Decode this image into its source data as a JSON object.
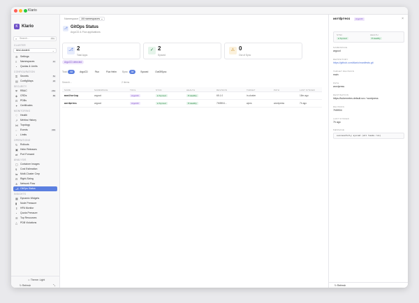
{
  "window": {
    "title": "Klario"
  },
  "sidebar": {
    "brand": "Klario",
    "logo_letter": "K",
    "search_placeholder": "Search...",
    "search_kbd": "⌘K",
    "cluster_label": "CLUSTER",
    "cluster_value": "kind-cluster1",
    "sections": [
      {
        "label": "CLUSTER",
        "items": [
          {
            "label": "Settings",
            "icon": "gear-icon",
            "badge": ""
          },
          {
            "label": "Namespaces",
            "icon": "layers-icon",
            "badge": "12"
          },
          {
            "label": "Quotas & Limits",
            "icon": "gauge-icon",
            "badge": ""
          }
        ]
      },
      {
        "label": "CONFIGURATION",
        "items": [
          {
            "label": "Secrets",
            "icon": "key-icon",
            "badge": "52"
          },
          {
            "label": "ConfigMaps",
            "icon": "file-icon",
            "badge": "18"
          }
        ]
      },
      {
        "label": "SECURITY",
        "items": [
          {
            "label": "RBAC",
            "icon": "shield-icon",
            "badge": "262"
          },
          {
            "label": "CRDs",
            "icon": "cube-icon",
            "badge": "88"
          },
          {
            "label": "PDBs",
            "icon": "lock-icon",
            "badge": ""
          },
          {
            "label": "Certificates",
            "icon": "certificate-icon",
            "badge": ""
          }
        ]
      },
      {
        "label": "MONITORING",
        "items": [
          {
            "label": "Health",
            "icon": "heart-icon",
            "badge": ""
          },
          {
            "label": "Metrics History",
            "icon": "chart-icon",
            "badge": ""
          },
          {
            "label": "Topology",
            "icon": "graph-icon",
            "badge": ""
          },
          {
            "label": "Events",
            "icon": "bell-icon",
            "badge": "393"
          },
          {
            "label": "Limits",
            "icon": "gauge-icon",
            "badge": ""
          }
        ]
      },
      {
        "label": "OPERATIONS",
        "items": [
          {
            "label": "Rollouts",
            "icon": "refresh-icon",
            "badge": ""
          },
          {
            "label": "Helm Releases",
            "icon": "package-icon",
            "badge": ""
          },
          {
            "label": "Port Forward",
            "icon": "plug-icon",
            "badge": ""
          }
        ]
      },
      {
        "label": "ANALYSIS",
        "items": [
          {
            "label": "Container Images",
            "icon": "box-icon",
            "badge": ""
          },
          {
            "label": "Cost Estimation",
            "icon": "dollar-icon",
            "badge": ""
          },
          {
            "label": "Multi-Cluster Cmp",
            "icon": "compare-icon",
            "badge": ""
          },
          {
            "label": "Right-Sizing",
            "icon": "ruler-icon",
            "badge": ""
          },
          {
            "label": "Network Flow",
            "icon": "network-icon",
            "badge": ""
          },
          {
            "label": "GitOps Status",
            "icon": "git-icon",
            "badge": "",
            "active": true
          }
        ]
      },
      {
        "label": "INSIGHTS",
        "items": [
          {
            "label": "Dynamic Widgets",
            "icon": "grid-icon",
            "badge": ""
          },
          {
            "label": "Node Pressure",
            "icon": "thermometer-icon",
            "badge": ""
          },
          {
            "label": "HPA Monitor",
            "icon": "scale-icon",
            "badge": ""
          },
          {
            "label": "Quota Pressure",
            "icon": "gauge-icon",
            "badge": ""
          },
          {
            "label": "Top Resources",
            "icon": "list-icon",
            "badge": ""
          },
          {
            "label": "PDB Violations",
            "icon": "warning-icon",
            "badge": ""
          }
        ]
      }
    ],
    "theme_label": "Theme: Light",
    "refresh_label": "Refresh"
  },
  "main": {
    "breadcrumb_parent": "Namespace",
    "breadcrumb_current": "All namespaces",
    "title": "GitOps Status",
    "subtitle": "ArgoCD & Flux applications",
    "cards": [
      {
        "value": "2",
        "label": "Total Apps",
        "icon": "git-icon",
        "color": "#5b7fe0",
        "bg": "#e7ecfb"
      },
      {
        "value": "2",
        "label": "Synced",
        "icon": "check-icon",
        "color": "#2d8a49",
        "bg": "#e5f4ea"
      },
      {
        "value": "0",
        "label": "Out of Sync",
        "icon": "warning-icon",
        "color": "#c98a1c",
        "bg": "#fbf1dc"
      }
    ],
    "detected_pill": "ArgoCD detected",
    "filter_tool_label": "Tool:",
    "filter_tools": [
      "All",
      "ArgoCD",
      "Flux",
      "Flux Helm"
    ],
    "filter_sync_label": "Sync:",
    "filter_syncs": [
      "All",
      "Synced",
      "OutOfSync"
    ],
    "search_placeholder": "Search...",
    "search_count": "2 items",
    "columns": [
      "NAME",
      "NAMESPACE",
      "TOOL",
      "SYNC",
      "HEALTH",
      "REVISION",
      "TARGET",
      "PATH",
      "LAST SYNCED"
    ],
    "rows": [
      {
        "name": "monitoring",
        "namespace": "argocd",
        "tool": "ArgoCD",
        "sync": "Synced",
        "health": "Healthy",
        "revision": "65.1.0",
        "target": "in-cluster",
        "path": "",
        "last_synced": "18m ago"
      },
      {
        "name": "wordpress",
        "namespace": "argocd",
        "tool": "ArgoCD",
        "sync": "Synced",
        "health": "Healthy",
        "revision": "7f45904...",
        "target": "wpns",
        "path": "wordpress",
        "last_synced": "7h ago"
      }
    ]
  },
  "detail": {
    "title": "wordpress",
    "badge": "ArgoCD",
    "sync_label": "SYNC",
    "sync_value": "Synced",
    "health_label": "HEALTH",
    "health_value": "Healthy",
    "fields": [
      {
        "label": "NAMESPACE",
        "value": "argocd",
        "link": false
      },
      {
        "label": "REPOSITORY",
        "value": "https://github.com/klario/manifests.git",
        "link": true
      },
      {
        "label": "TARGET REVISION",
        "value": "main",
        "link": false
      },
      {
        "label": "PATH",
        "value": "wordpress",
        "link": false
      },
      {
        "label": "DESTINATION",
        "value": "https://kubernetes.default.svc / wordpress",
        "link": false
      },
      {
        "label": "REVISION",
        "value": "7f45904",
        "link": false
      },
      {
        "label": "LAST SYNCED",
        "value": "7h ago",
        "link": false
      }
    ],
    "message_label": "MESSAGE",
    "message": "successfully synced (all tasks run)",
    "refresh_label": "Refresh"
  }
}
